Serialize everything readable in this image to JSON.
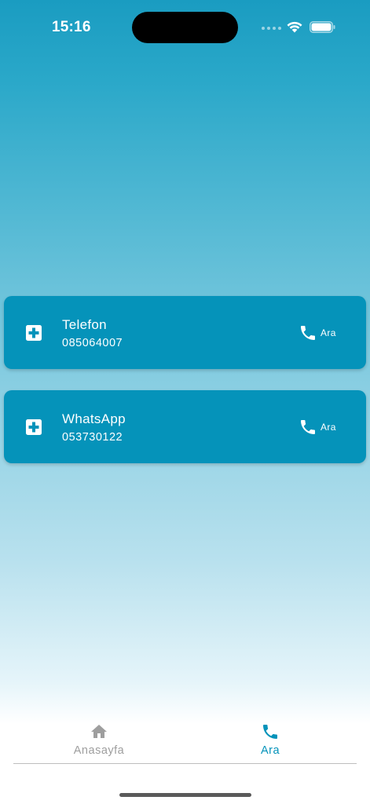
{
  "status_bar": {
    "time": "15:16"
  },
  "contacts": [
    {
      "title": "Telefon",
      "number": "085064007",
      "call_label": "Ara",
      "icon": "medical-plus-icon"
    },
    {
      "title": "WhatsApp",
      "number": "053730122",
      "call_label": "Ara",
      "icon": "medical-plus-icon"
    }
  ],
  "bottom_nav": {
    "items": [
      {
        "label": "Anasayfa",
        "icon": "home-icon",
        "active": false
      },
      {
        "label": "Ara",
        "icon": "phone-icon",
        "active": true
      }
    ]
  },
  "colors": {
    "card": "#0593ba",
    "active_nav": "#0593ba",
    "inactive_nav": "#9e9e9e"
  }
}
